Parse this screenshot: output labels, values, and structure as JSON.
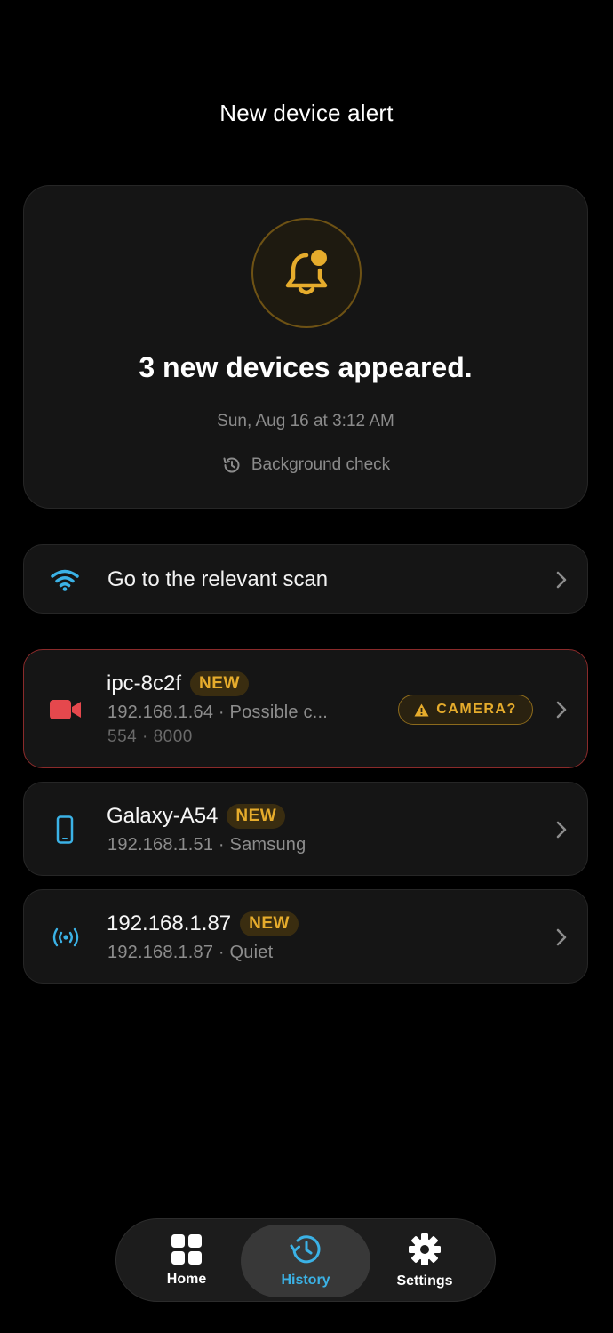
{
  "header": {
    "title": "New device alert"
  },
  "alert": {
    "headline": "3 new devices appeared.",
    "timestamp": "Sun, Aug 16 at 3:12 AM",
    "source": "Background check",
    "icon": "bell-alert-icon"
  },
  "scan_link": {
    "label": "Go to the relevant scan",
    "icon": "wifi-icon"
  },
  "devices": [
    {
      "name": "ipc-8c2f",
      "badge": "NEW",
      "subtitle": "192.168.1.64 · Possible c...",
      "ports": "554 · 8000",
      "warning": "CAMERA?",
      "icon": "video-camera-icon",
      "icon_color": "#e5484d"
    },
    {
      "name": "Galaxy-A54",
      "badge": "NEW",
      "subtitle": "192.168.1.51 · Samsung",
      "icon": "phone-icon",
      "icon_color": "#3bb2e6"
    },
    {
      "name": "192.168.1.87",
      "badge": "NEW",
      "subtitle": "192.168.1.87 · Quiet",
      "icon": "broadcast-icon",
      "icon_color": "#3bb2e6"
    }
  ],
  "nav": {
    "items": [
      {
        "label": "Home",
        "icon": "grid-icon"
      },
      {
        "label": "History",
        "icon": "history-icon",
        "active": true
      },
      {
        "label": "Settings",
        "icon": "gear-icon"
      }
    ]
  },
  "colors": {
    "accent": "#3bb2e6",
    "warning": "#e6ac2c",
    "danger": "#e5484d",
    "background": "#000000"
  }
}
